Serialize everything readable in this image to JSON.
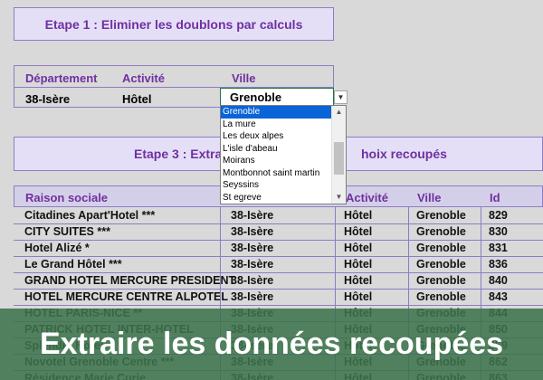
{
  "step1": {
    "title": "Etape 1 : Eliminer les doublons par calculs"
  },
  "criteria": {
    "headers": [
      "Département",
      "Activité",
      "Ville"
    ],
    "values": [
      "38-Isère",
      "Hôtel",
      "Grenoble"
    ]
  },
  "dropdown": {
    "selected": "Grenoble",
    "options": [
      "Grenoble",
      "La mure",
      "Les deux alpes",
      "L'isle d'abeau",
      "Moirans",
      "Montbonnot saint martin",
      "Seyssins",
      "St egreve"
    ]
  },
  "step3": {
    "title_left": "Etape 3 : Extra",
    "title_right": "hoix recoupés"
  },
  "results": {
    "headers": [
      "Raison sociale",
      "Activité",
      "Ville",
      "Id"
    ],
    "rows": [
      [
        "Citadines Apart'Hotel ***",
        "38-Isère",
        "Hôtel",
        "Grenoble",
        "829"
      ],
      [
        "CITY SUITES ***",
        "38-Isère",
        "Hôtel",
        "Grenoble",
        "830"
      ],
      [
        "Hotel Alizé *",
        "38-Isère",
        "Hôtel",
        "Grenoble",
        "831"
      ],
      [
        "Le Grand Hôtel ***",
        "38-Isère",
        "Hôtel",
        "Grenoble",
        "836"
      ],
      [
        "GRAND HOTEL MERCURE PRESIDENT",
        "38-Isère",
        "Hôtel",
        "Grenoble",
        "840"
      ],
      [
        "HOTEL MERCURE CENTRE ALPOTEL",
        "38-Isère",
        "Hôtel",
        "Grenoble",
        "843"
      ],
      [
        "HOTEL PARIS-NICE **",
        "38-Isère",
        "Hôtel",
        "Grenoble",
        "844"
      ],
      [
        "PATRICK HOTEL INTER-HOTEL",
        "38-Isère",
        "Hôtel",
        "Grenoble",
        "850"
      ],
      [
        "Splendid Hôtel",
        "38-Isère",
        "Hôtel",
        "Grenoble",
        "859"
      ],
      [
        "Novotel Grenoble Centre ***",
        "38-Isère",
        "Hôtel",
        "Grenoble",
        "862"
      ],
      [
        "Résidence Marie Curie",
        "38-Isère",
        "Hôtel",
        "Grenoble",
        "863"
      ]
    ]
  },
  "banner": {
    "text": "Extraire les données recoupées"
  },
  "colors": {
    "accent": "#7030a0",
    "header_bg": "#e4dff7",
    "banner": "#3c734b",
    "selection": "#0a64d7"
  }
}
